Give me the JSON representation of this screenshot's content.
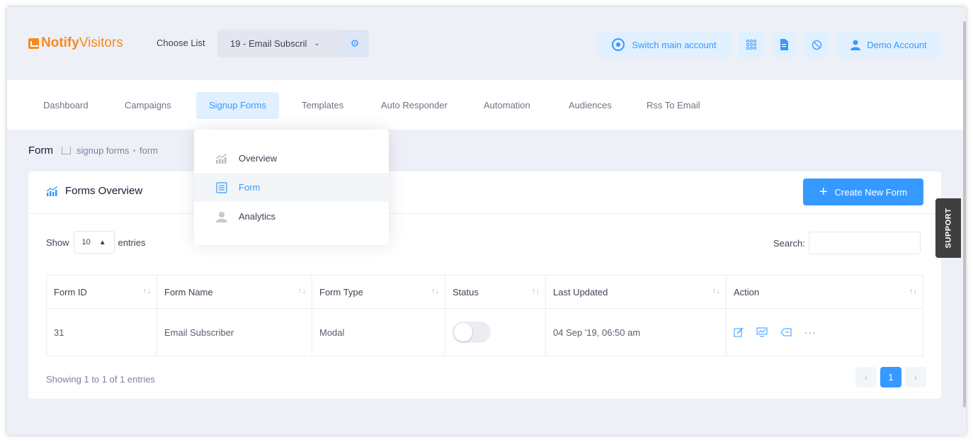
{
  "brand": {
    "name_a": "Notify",
    "name_b": "Visitors",
    "color": "#f58a1f"
  },
  "topbar": {
    "choose_list_label": "Choose List",
    "selected_list": "19 - Email Subscril",
    "switch_account_label": "Switch main account",
    "account_label": "Demo Account",
    "accent": "#3699ff"
  },
  "nav": {
    "items": [
      {
        "label": "Dashboard"
      },
      {
        "label": "Campaigns"
      },
      {
        "label": "Signup Forms",
        "active": true
      },
      {
        "label": "Templates"
      },
      {
        "label": "Auto Responder"
      },
      {
        "label": "Automation"
      },
      {
        "label": "Audiences"
      },
      {
        "label": "Rss To Email"
      }
    ]
  },
  "dropdown": {
    "items": [
      {
        "label": "Overview",
        "icon": "chart-icon"
      },
      {
        "label": "Form",
        "icon": "form-icon",
        "active": true
      },
      {
        "label": "Analytics",
        "icon": "analytics-icon"
      }
    ]
  },
  "subheader": {
    "title": "Form",
    "crumb_1": "signup forms",
    "separator": "•",
    "crumb_2": "form"
  },
  "card": {
    "title": "Forms Overview",
    "create_button": "Create New Form",
    "show_label": "Show",
    "entries_count": "10",
    "entries_label": "entries",
    "search_label": "Search:",
    "search_value": "",
    "columns": [
      "Form ID",
      "Form Name",
      "Form Type",
      "Status",
      "Last Updated",
      "Action"
    ],
    "rows": [
      {
        "id": "31",
        "name": "Email Subscriber",
        "type": "Modal",
        "status_on": false,
        "updated": "04 Sep '19, 06:50 am"
      }
    ],
    "info": "Showing 1 to 1 of 1 entries",
    "pagination": {
      "prev": "‹",
      "current": "1",
      "next": "›"
    }
  },
  "support_label": "SUPPORT"
}
